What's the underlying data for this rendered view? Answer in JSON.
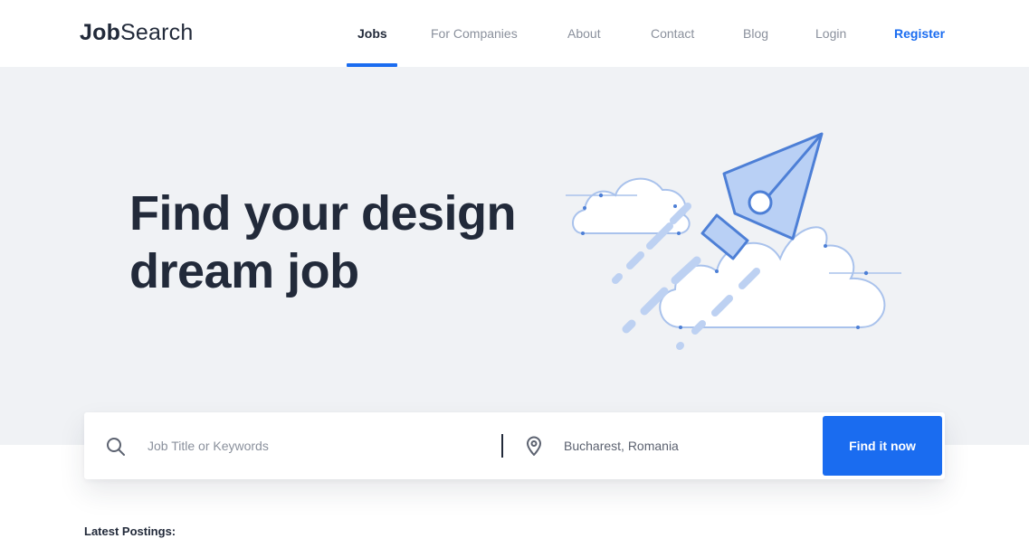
{
  "brand": {
    "logo_bold": "Job",
    "logo_light": "Search"
  },
  "nav": {
    "items": [
      {
        "label": "Jobs",
        "active": true
      },
      {
        "label": "For Companies"
      },
      {
        "label": "About"
      },
      {
        "label": "Contact"
      },
      {
        "label": "Blog"
      },
      {
        "label": "Login"
      },
      {
        "label": "Register"
      }
    ]
  },
  "hero": {
    "title_line1": "Find your design",
    "title_line2": "dream job"
  },
  "search": {
    "keyword_placeholder": "Job Title or Keywords",
    "location_value": "Bucharest, Romania",
    "button_label": "Find it now"
  },
  "section": {
    "latest_label": "Latest Postings:"
  },
  "colors": {
    "accent": "#1a6cf0",
    "text": "#222a3a",
    "muted": "#8a909c",
    "hero_bg": "#f0f2f5"
  }
}
